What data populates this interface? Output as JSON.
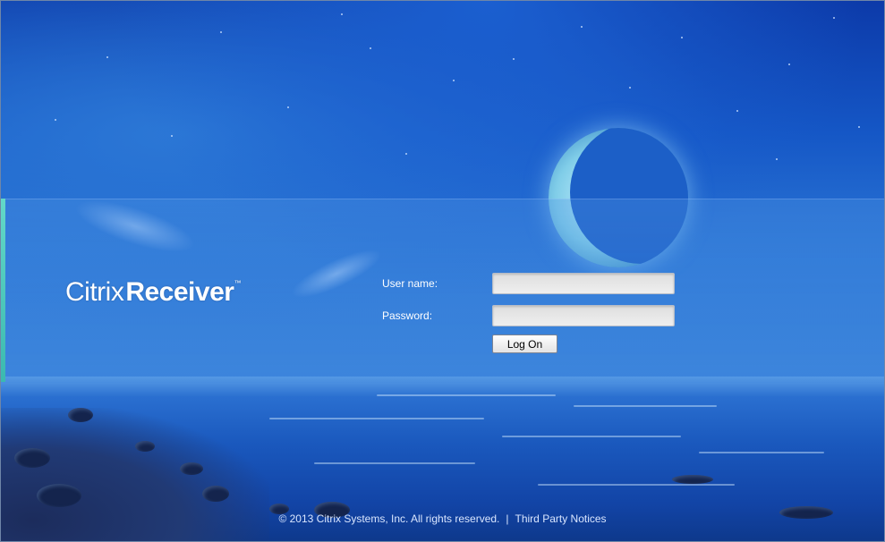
{
  "brand": {
    "name_light": "Citrix",
    "name_bold": "Receiver",
    "trademark": "™"
  },
  "login_form": {
    "username_label": "User name:",
    "username_value": "",
    "password_label": "Password:",
    "password_value": "",
    "logon_button_label": "Log On"
  },
  "footer": {
    "copyright": "© 2013 Citrix Systems, Inc. All rights reserved.",
    "separator": "|",
    "third_party_link": "Third Party Notices"
  },
  "colors": {
    "sky_top": "#0c3aa9",
    "sea": "#1a58bd",
    "accent_strip": "#63d8c8",
    "text": "#ffffff"
  }
}
